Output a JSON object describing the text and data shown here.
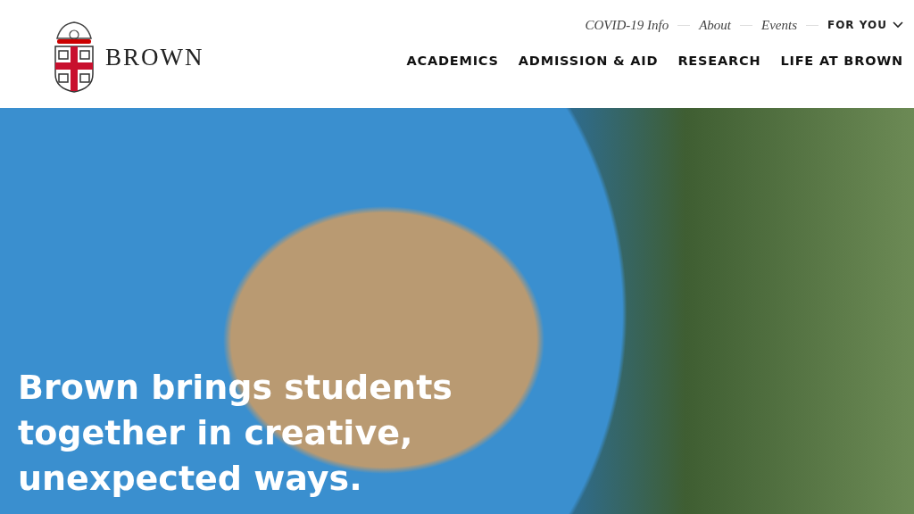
{
  "logo": {
    "wordmark": "BROWN"
  },
  "utility_nav": [
    {
      "label": "COVID-19 Info",
      "kind": "link"
    },
    {
      "label": "About",
      "kind": "link"
    },
    {
      "label": "Events",
      "kind": "link"
    },
    {
      "label": "FOR YOU",
      "kind": "dropdown"
    }
  ],
  "main_nav": [
    "ACADEMICS",
    "ADMISSION & AID",
    "RESEARCH",
    "LIFE AT BROWN"
  ],
  "hero": {
    "headline": "Brown brings students together in creative, unexpected ways."
  }
}
